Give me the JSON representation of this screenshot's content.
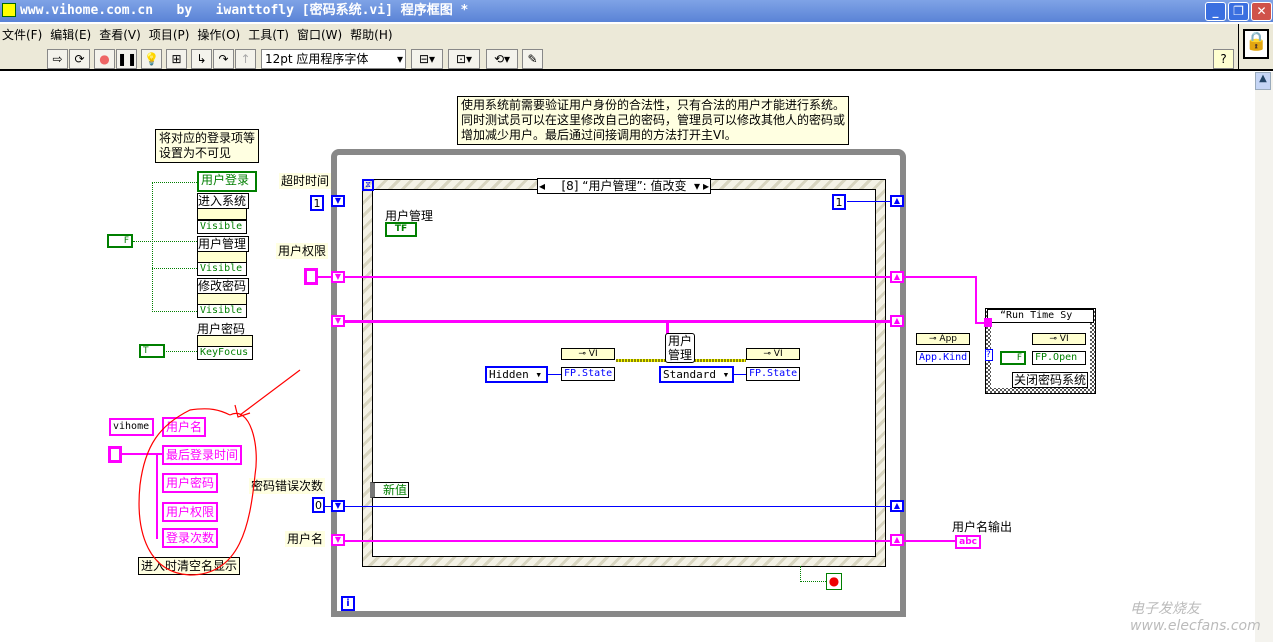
{
  "window": {
    "title": "www.vihome.com.cn   by   iwanttofly [密码系统.vi] 程序框图 *",
    "minimize": "_",
    "restore": "❐",
    "close": "✕"
  },
  "menu": [
    "文件(F)",
    "编辑(E)",
    "查看(V)",
    "项目(P)",
    "操作(O)",
    "工具(T)",
    "窗口(W)",
    "帮助(H)"
  ],
  "toolbar": {
    "font": "12pt 应用程序字体",
    "help": "?"
  },
  "comments": {
    "top": "使用系统前需要验证用户身份的合法性，只有合法的用户才能进行系统。\n同时测试员可以在这里修改自己的密码，管理员可以修改其他人的密码或\n增加减少用户。最后通过间接调用的方法打开主VI。",
    "left": "将对应的登录项等\n设置为不可见"
  },
  "left_nodes": {
    "login": "用户登录",
    "items": [
      {
        "name": "进入系统",
        "prop": "Visible"
      },
      {
        "name": "用户管理",
        "prop": "Visible"
      },
      {
        "name": "修改密码",
        "prop": "Visible"
      }
    ],
    "pwd": "用户密码",
    "pwd_prop": "KeyFocus",
    "false_const": "F",
    "true_const": "T"
  },
  "cluster": {
    "const": "vihome",
    "fields": [
      "用户名",
      "最后登录时间",
      "用户密码",
      "用户权限",
      "登录次数"
    ],
    "label": "进入时清空名显示"
  },
  "loop_labels": {
    "timeout": "超时时间",
    "timeout_val": "1",
    "perm": "用户权限",
    "pwd_err": "密码错误次数",
    "pwd_err_val": "0",
    "username": "用户名",
    "iter": "i"
  },
  "event": {
    "selector": "[8] “用户管理”: 值改变",
    "control": "用户管理",
    "tf": "TF",
    "new_value": "新值",
    "return_val": "1"
  },
  "nodes": {
    "hidden": "Hidden",
    "standard": "Standard",
    "vi": "VI",
    "fp_state": "FP.State",
    "user_mgmt": "用户\n管理"
  },
  "right": {
    "app": "App",
    "app_kind": "App.Kind",
    "case": "“Run Time Sy",
    "vi": "VI",
    "fp_open": "FP.Open",
    "case_label": "关闭密码系统",
    "false_const": "F",
    "out_label": "用户名输出",
    "out_ind": "abc"
  },
  "watermark": "电子发烧友 www.elecfans.com"
}
